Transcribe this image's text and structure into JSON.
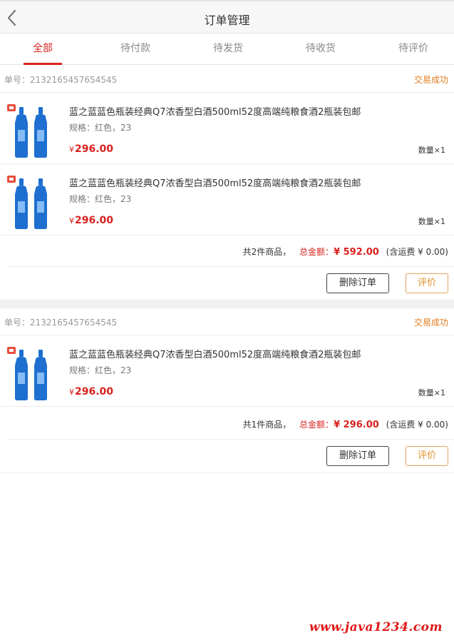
{
  "header": {
    "title": "订单管理",
    "back_icon": "chevron-left-icon"
  },
  "tabs": [
    {
      "label": "全部",
      "active": true
    },
    {
      "label": "待付款",
      "active": false
    },
    {
      "label": "待发货",
      "active": false
    },
    {
      "label": "待收货",
      "active": false
    },
    {
      "label": "待评价",
      "active": false
    }
  ],
  "orders": [
    {
      "order_no": "单号：2132165457654545",
      "status": "交易成功",
      "items": [
        {
          "name": "蓝之蓝蓝色瓶装经典Q7浓香型白酒500ml52度高端纯粮食酒2瓶装包邮",
          "spec": "规格：红色，23",
          "yen": "¥",
          "price": "296.00",
          "qty": "数量×1"
        },
        {
          "name": "蓝之蓝蓝色瓶装经典Q7浓香型白酒500ml52度高端纯粮食酒2瓶装包邮",
          "spec": "规格：红色，23",
          "yen": "¥",
          "price": "296.00",
          "qty": "数量×1"
        }
      ],
      "count_text": "共2件商品，",
      "total_label": "总金额：",
      "total_value": "¥ 592.00",
      "shipping": "(含运费 ¥ 0.00)",
      "delete_label": "删除订单",
      "review_label": "评价"
    },
    {
      "order_no": "单号：2132165457654545",
      "status": "交易成功",
      "items": [
        {
          "name": "蓝之蓝蓝色瓶装经典Q7浓香型白酒500ml52度高端纯粮食酒2瓶装包邮",
          "spec": "规格：红色，23",
          "yen": "¥",
          "price": "296.00",
          "qty": "数量×1"
        }
      ],
      "count_text": "共1件商品，",
      "total_label": "总金额：",
      "total_value": "¥ 296.00",
      "shipping": "(含运费 ¥ 0.00)",
      "delete_label": "删除订单",
      "review_label": "评价"
    }
  ],
  "watermark": "www.java1234.com",
  "colors": {
    "accent": "#d8221e",
    "status": "#e07c22",
    "review_border": "#e0a25e",
    "bottle": "#1e6fd0"
  }
}
